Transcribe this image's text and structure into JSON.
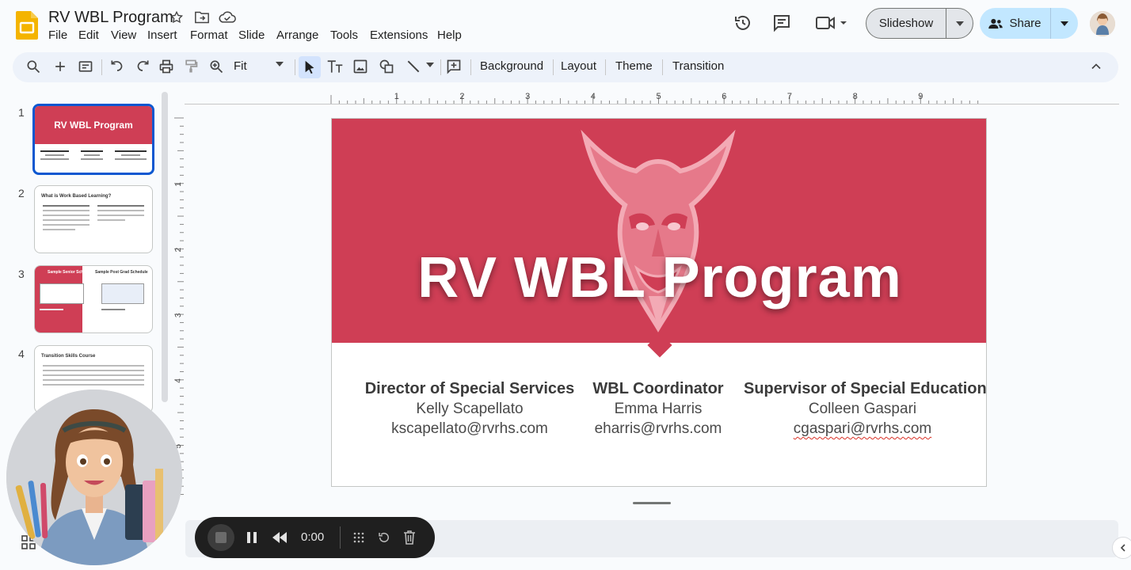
{
  "app": {
    "doc_title": "RV WBL Program",
    "menu": [
      "File",
      "Edit",
      "View",
      "Insert",
      "Format",
      "Slide",
      "Arrange",
      "Tools",
      "Extensions",
      "Help"
    ],
    "slideshow_label": "Slideshow",
    "share_label": "Share",
    "brand_color": "#f4b400",
    "accent_color": "#0b57d0"
  },
  "toolbar": {
    "zoom_value": "Fit",
    "background_label": "Background",
    "layout_label": "Layout",
    "theme_label": "Theme",
    "transition_label": "Transition",
    "icons": [
      "search-icon",
      "add-icon",
      "new-slide-icon",
      "undo-icon",
      "redo-icon",
      "print-icon",
      "paint-format-icon",
      "zoom-icon",
      "select-icon",
      "text-box-icon",
      "image-icon",
      "shape-icon",
      "line-icon",
      "comment-add-icon",
      "collapse-icon"
    ]
  },
  "filmstrip": {
    "slides": [
      {
        "number": "1",
        "title": "RV WBL Program",
        "active": true
      },
      {
        "number": "2",
        "title": "What is Work Based Learning?",
        "active": false
      },
      {
        "number": "3",
        "title": "Sample Senior Schedule",
        "title2": "Sample Post Grad Schedule",
        "active": false
      },
      {
        "number": "4",
        "title": "Transition Skills Course",
        "active": false
      }
    ]
  },
  "ruler": {
    "h_labels": [
      "1",
      "2",
      "3",
      "4",
      "5",
      "6",
      "7",
      "8",
      "9"
    ],
    "v_labels": [
      "1",
      "2",
      "3",
      "4",
      "5"
    ]
  },
  "slide": {
    "title": "RV WBL Program",
    "banner_color": "#cf3e55",
    "contacts": [
      {
        "role": "Director of Special Services",
        "name": "Kelly Scapellato",
        "email": "kscapellato@rvrhs.com"
      },
      {
        "role": "WBL Coordinator",
        "name": "Emma Harris",
        "email": "eharris@rvrhs.com"
      },
      {
        "role": "Supervisor of Special Education",
        "name": "Colleen Gaspari",
        "email": "cgaspari@rvrhs.com"
      }
    ]
  },
  "recorder": {
    "time": "0:00"
  }
}
